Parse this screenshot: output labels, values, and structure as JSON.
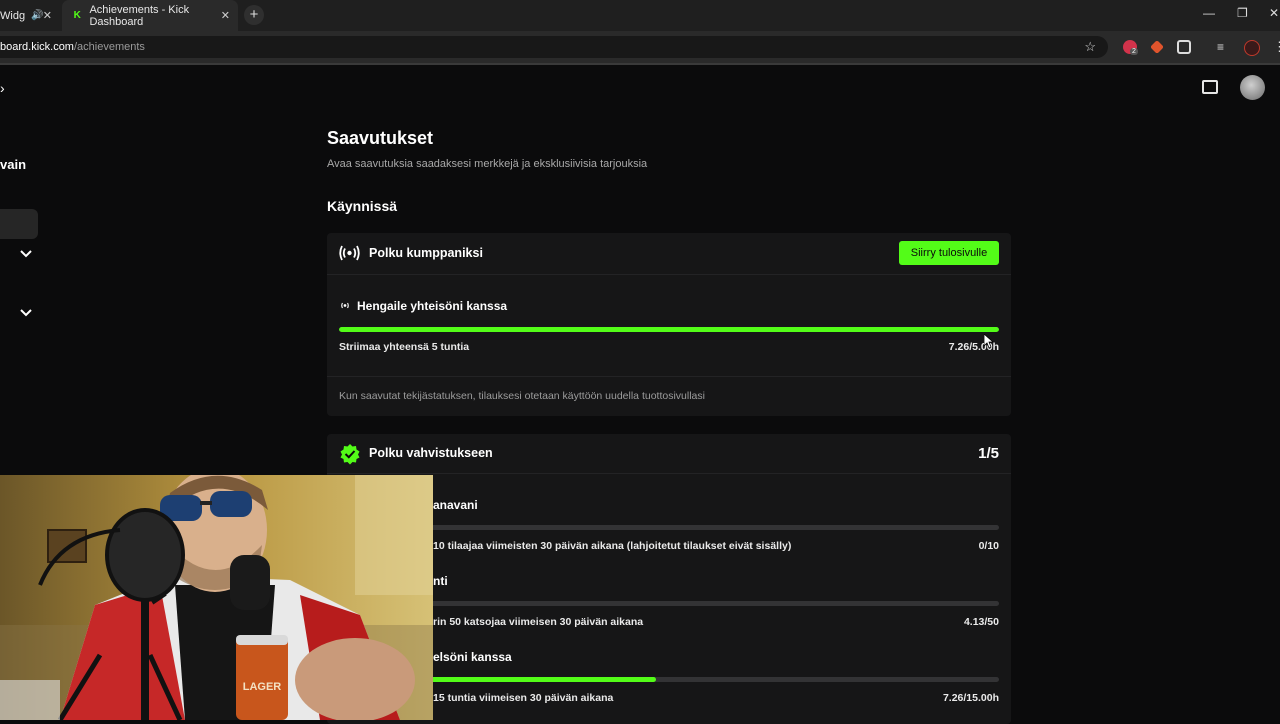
{
  "browser": {
    "tab1_label": "Widg",
    "tab2_label": "Achievements - Kick Dashboard",
    "url_host": "board.kick.com",
    "url_path": "/achievements",
    "extension_badge": "2"
  },
  "sidebar": {
    "label": "vain"
  },
  "page": {
    "title": "Saavutukset",
    "subtitle": "Avaa saavutuksia saadaksesi merkkejä ja eksklusiivisia tarjouksia",
    "section": "Käynnissä"
  },
  "card1": {
    "title": "Polku kumppaniksi",
    "button": "Siirry tulosivulle",
    "item_title": "Hengaile yhteisöni kanssa",
    "item_desc": "Striimaa yhteensä 5 tuntia",
    "item_value": "7.26/5.00h",
    "progress": 1.0,
    "note": "Kun saavutat tekijästatuksen, tilauksesi otetaan käyttöön uudella tuottosivullasi"
  },
  "card2": {
    "title": "Polku vahvistukseen",
    "count": "1/5",
    "items": [
      {
        "title": "anavani",
        "desc": "10 tilaajaa viimeisten 30 päivän aikana (lahjoitetut tilaukset eivät sisälly)",
        "value": "0/10",
        "progress": 0.0
      },
      {
        "title": "nti",
        "desc": "rin 50 katsojaa viimeisen 30 päivän aikana",
        "value": "4.13/50",
        "progress": 0.08
      },
      {
        "title": "elsöni kanssa",
        "desc": "15 tuntia viimeisen 30 päivän aikana",
        "value": "7.26/15.00h",
        "progress": 0.48
      }
    ]
  },
  "webcam": {
    "can_text": "LAGER"
  },
  "colors": {
    "accent": "#53fc18",
    "background": "#0b0b0c",
    "card": "#161617"
  }
}
